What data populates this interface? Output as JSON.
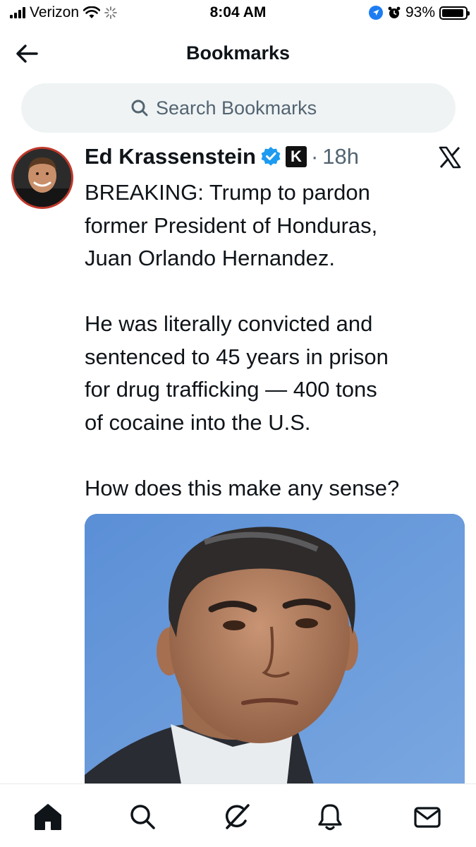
{
  "status_bar": {
    "carrier": "Verizon",
    "time": "8:04 AM",
    "battery": "93%",
    "battery_level": 0.93,
    "icons": [
      "signal-icon",
      "wifi-icon",
      "activity-icon",
      "location-icon",
      "alarm-icon",
      "battery-icon"
    ]
  },
  "header": {
    "title": "Bookmarks",
    "back_icon": "arrow-left-icon"
  },
  "search": {
    "placeholder": "Search Bookmarks",
    "value": "",
    "icon": "search-icon"
  },
  "tweet": {
    "author": "Ed Krassenstein",
    "verified": true,
    "badge_letter": "K",
    "separator": "·",
    "time": "18h",
    "text": "BREAKING: Trump to pardon\nformer President of Honduras,\nJuan Orlando Hernandez.\n\nHe was literally convicted and\nsentenced to 45 years in prison\nfor drug trafficking — 400 tons\nof cocaine into the U.S.\n\nHow does this make any sense?",
    "has_photo": true,
    "colors": {
      "verified": "#1d9bf0",
      "avatar_ring": "#c0392b",
      "photo_bg": "#6d9ad6"
    }
  },
  "bottom_nav": {
    "items": [
      "home-icon",
      "search-icon",
      "grok-icon",
      "notifications-icon",
      "messages-icon"
    ]
  }
}
